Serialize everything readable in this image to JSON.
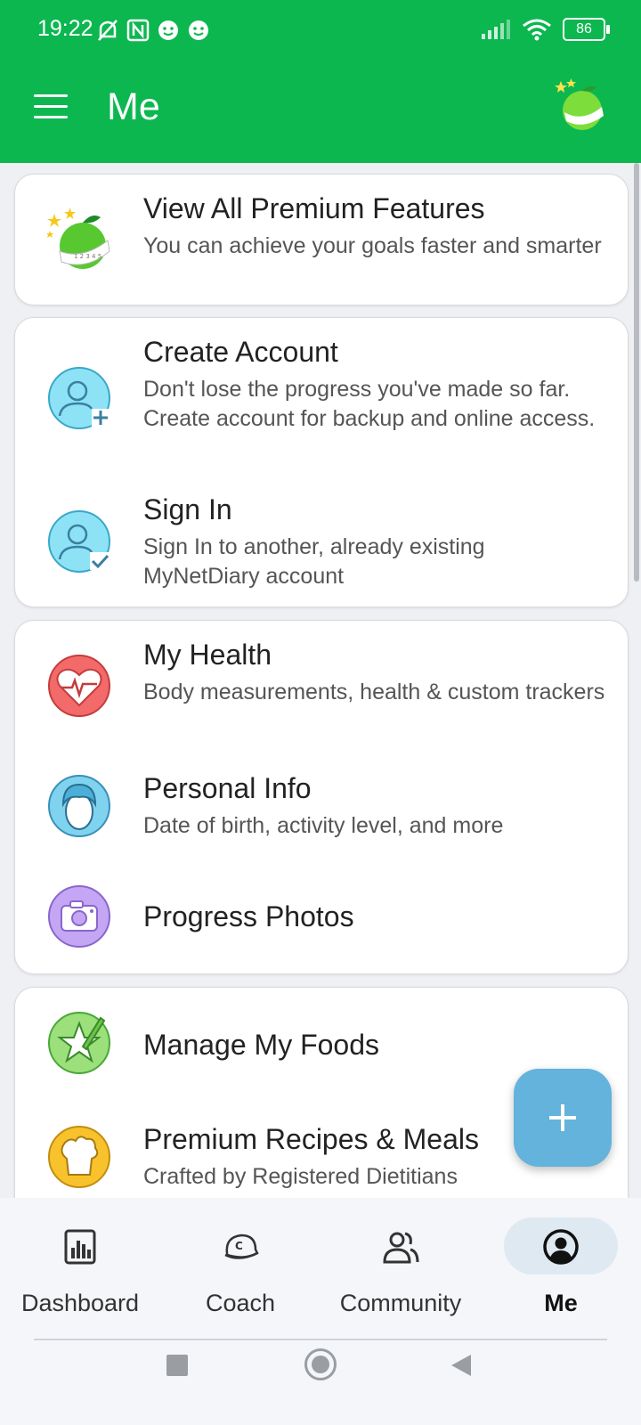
{
  "status_bar": {
    "time": "19:22",
    "battery": "86",
    "icons": [
      "bell-off-icon",
      "nfc-icon",
      "smiley-icon",
      "smiley-icon",
      "signal-icon",
      "wifi-icon",
      "battery-icon"
    ]
  },
  "app_bar": {
    "title": "Me",
    "menu_icon": "hamburger-icon",
    "logo_icon": "apple-tape-logo-icon"
  },
  "cards": {
    "premium": {
      "title": "View All Premium Features",
      "subtitle": "You can achieve your goals faster and smarter",
      "icon": "premium-apple-icon"
    },
    "create_account": {
      "title": "Create Account",
      "subtitle": "Don't lose the progress you've made so far. Create account for backup and online access.",
      "icon": "user-add-icon"
    },
    "sign_in": {
      "title": "Sign In",
      "subtitle": "Sign In to another, already existing MyNetDiary account",
      "icon": "user-check-icon"
    },
    "my_health": {
      "title": "My Health",
      "subtitle": "Body measurements, health & custom trackers",
      "icon": "heart-pulse-icon"
    },
    "personal_info": {
      "title": "Personal Info",
      "subtitle": "Date of birth, activity level, and more",
      "icon": "person-face-icon"
    },
    "progress_photos": {
      "title": "Progress Photos",
      "icon": "camera-icon"
    },
    "manage_foods": {
      "title": "Manage My Foods",
      "icon": "star-pencil-icon"
    },
    "recipes": {
      "title": "Premium Recipes & Meals",
      "subtitle": "Crafted by Registered Dietitians",
      "icon": "chef-hat-icon"
    }
  },
  "fab": {
    "icon": "plus-icon"
  },
  "bottom_nav": [
    {
      "label": "Dashboard",
      "icon": "bar-chart-icon",
      "active": false
    },
    {
      "label": "Coach",
      "icon": "coach-cap-icon",
      "active": false
    },
    {
      "label": "Community",
      "icon": "people-icon",
      "active": false
    },
    {
      "label": "Me",
      "icon": "profile-icon",
      "active": true
    }
  ],
  "colors": {
    "brand_green": "#0cb750",
    "fab_blue": "#63b3dc",
    "active_pill": "#dfe9f2"
  },
  "system_nav": [
    "recent-apps-icon",
    "home-icon",
    "back-icon"
  ]
}
